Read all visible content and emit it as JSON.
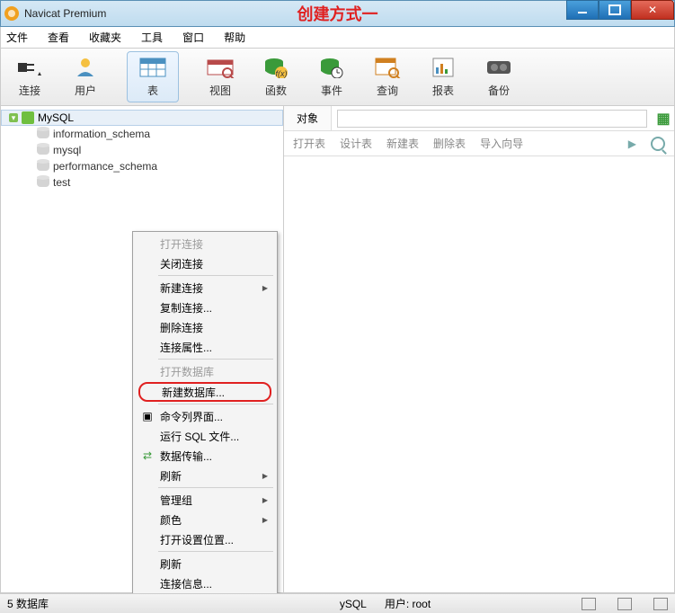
{
  "window": {
    "title": "Navicat Premium",
    "annotation": "创建方式一"
  },
  "menu": {
    "file": "文件",
    "view": "查看",
    "favorites": "收藏夹",
    "tools": "工具",
    "window": "窗口",
    "help": "帮助"
  },
  "toolbar": {
    "connect": "连接",
    "user": "用户",
    "table": "表",
    "view_obj": "视图",
    "function": "函数",
    "event": "事件",
    "query": "查询",
    "report": "报表",
    "backup": "备份"
  },
  "tree": {
    "root": "MySQL",
    "children": [
      "information_schema",
      "mysql",
      "performance_schema",
      "test"
    ]
  },
  "object_tab": "对象",
  "actions": {
    "open_table": "打开表",
    "design_table": "设计表",
    "new_table": "新建表",
    "delete_table": "删除表",
    "import_wizard": "导入向导"
  },
  "context": {
    "open_conn": "打开连接",
    "close_conn": "关闭连接",
    "new_conn": "新建连接",
    "dup_conn": "复制连接...",
    "del_conn": "删除连接",
    "conn_props": "连接属性...",
    "open_db": "打开数据库",
    "new_db": "新建数据库...",
    "cmd_iface": "命令列界面...",
    "run_sql": "运行 SQL 文件...",
    "data_trans": "数据传输...",
    "refresh1": "刷新",
    "manage_group": "管理组",
    "color": "颜色",
    "open_settings": "打开设置位置...",
    "refresh2": "刷新",
    "conn_info": "连接信息..."
  },
  "status": {
    "db_count": "5 数据库",
    "server": "ySQL",
    "user_label": "用户:",
    "user_value": "root"
  }
}
